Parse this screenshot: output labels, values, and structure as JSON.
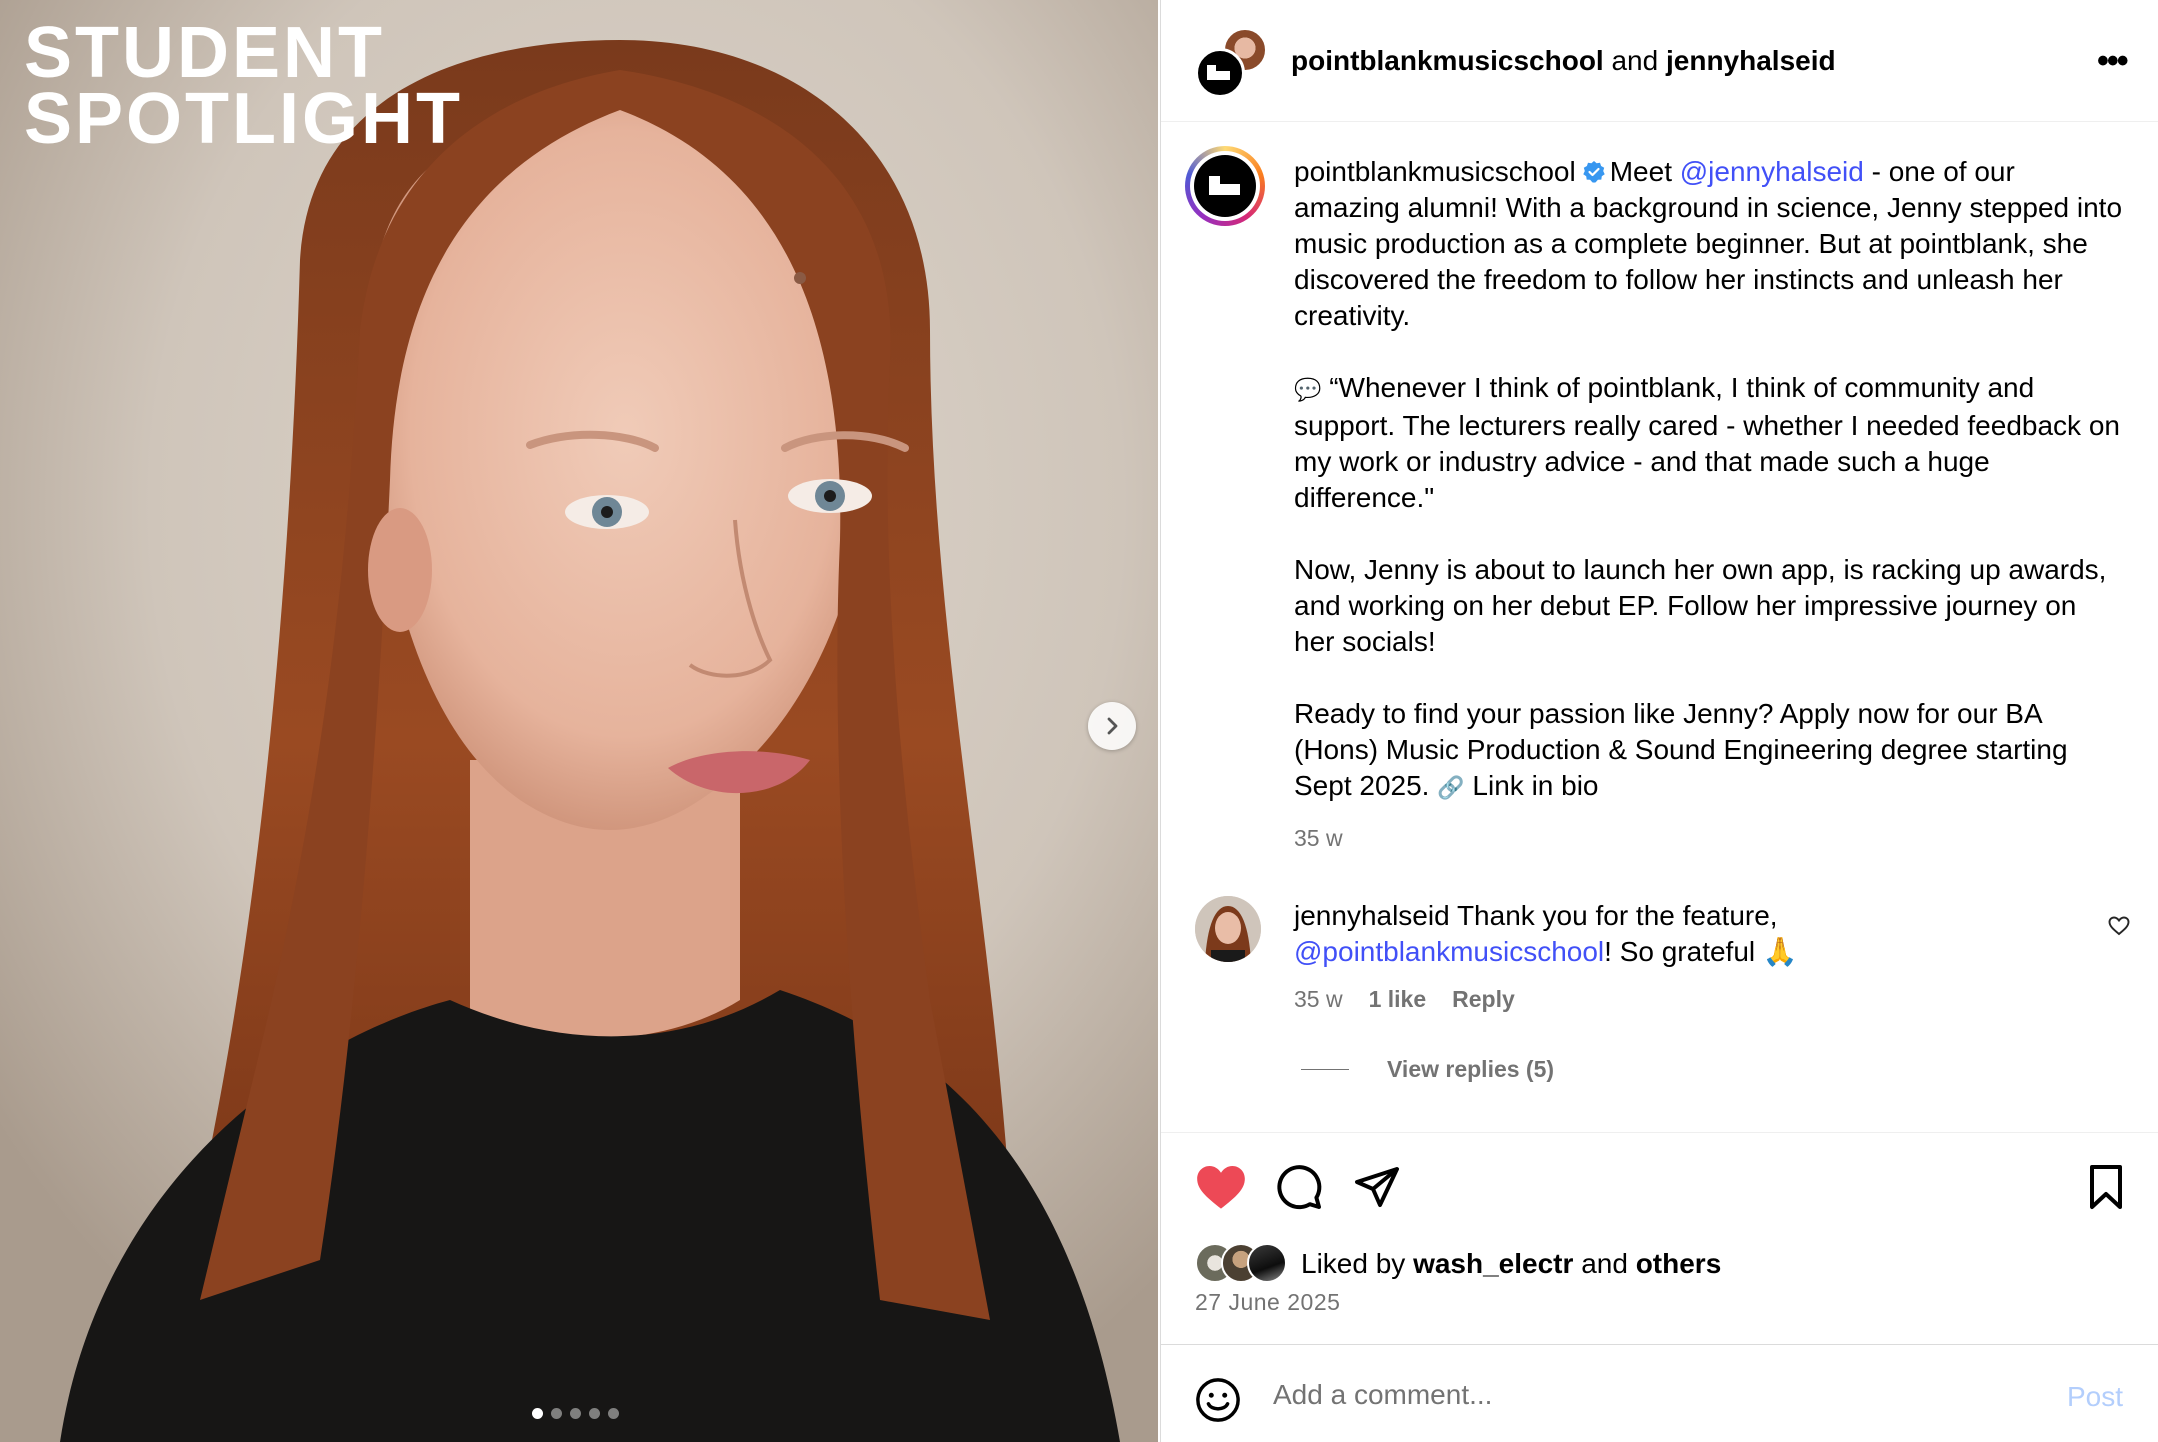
{
  "media": {
    "overlay_line1": "STUDENT",
    "overlay_line2": "SPOTLIGHT",
    "carousel_total": 5,
    "carousel_active": 1
  },
  "header": {
    "account1": "pointblankmusicschool",
    "joiner": "and",
    "account2": "jennyhalseid",
    "more_icon": "more-horizontal-icon"
  },
  "caption": {
    "username": "pointblankmusicschool",
    "intro_prefix": "Meet",
    "intro_mention": "@jennyhalseid",
    "intro_rest": "- one of our amazing alumni! With a background in science, Jenny stepped into music production as a complete beginner. But at pointblank, she discovered the freedom to follow her instincts and unleash her creativity.",
    "quote_icon": "💬",
    "quote": "“Whenever I think of pointblank, I think of community and support. The lecturers really cared - whether I needed feedback on my work or industry advice - and that made such a huge difference.\"",
    "paragraph3": "Now, Jenny is about to launch her own app, is racking up awards, and working on her debut EP. Follow her impressive journey on her socials!",
    "paragraph4": "Ready to find your passion like Jenny? Apply now for our BA (Hons) Music Production & Sound Engineering degree starting Sept 2025.",
    "link_icon": "🔗",
    "link_text": "Link in bio",
    "age": "35 w"
  },
  "comment": {
    "username": "jennyhalseid",
    "text_before": "Thank you for the feature,",
    "mention": "@pointblankmusicschool",
    "text_after": "! So grateful",
    "emoji": "🙏",
    "age": "35 w",
    "likes": "1 like",
    "reply": "Reply",
    "view_replies": "View replies (5)"
  },
  "actions": {
    "liked_by_prefix": "Liked by",
    "liked_by_user": "wash_electr",
    "liked_by_joiner": "and",
    "liked_by_others": "others",
    "date": "27 June 2025",
    "colors": {
      "like": "#ed4956",
      "mention": "#4150f7",
      "post": "#b3cefc"
    }
  },
  "comment_box": {
    "placeholder": "Add a comment...",
    "post_label": "Post"
  }
}
